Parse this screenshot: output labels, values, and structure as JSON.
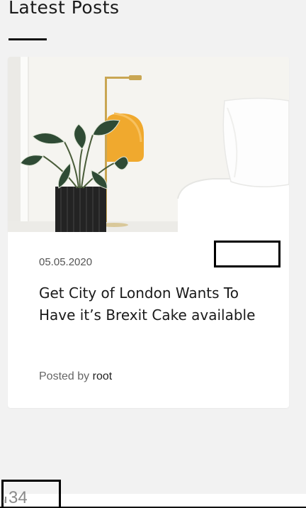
{
  "section": {
    "title": "Latest Posts"
  },
  "post": {
    "category": "",
    "date": "05.05.2020",
    "title": "Get City of London Wants To Have it’s Brexit Cake available",
    "posted_by_label": "Posted by",
    "author": "root"
  },
  "footer": {
    "counter": "34"
  },
  "colors": {
    "background": "#f2f2f2",
    "card": "#ffffff",
    "heading": "#1a1a1a",
    "muted_text": "#555555",
    "lamp": "#f0a92e",
    "plant": "#2f4b35"
  }
}
